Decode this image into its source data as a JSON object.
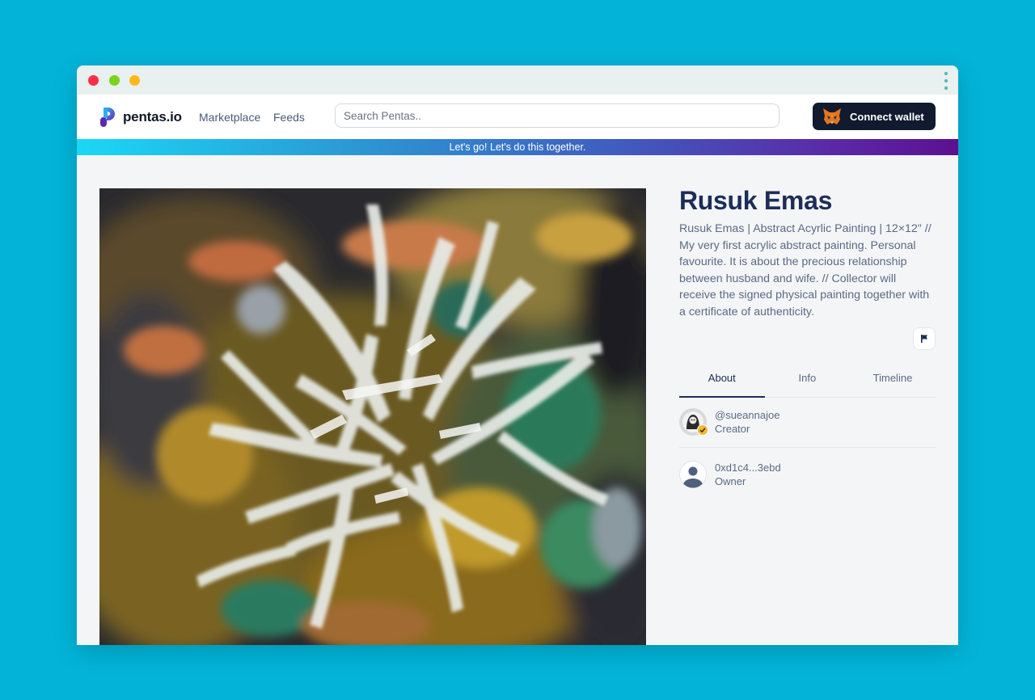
{
  "window": {
    "controls": [
      "close",
      "minimize",
      "maximize"
    ]
  },
  "brand": {
    "name": "pentas.io"
  },
  "nav": {
    "links": [
      "Marketplace",
      "Feeds"
    ]
  },
  "search": {
    "placeholder": "Search Pentas.."
  },
  "wallet": {
    "button_label": "Connect wallet",
    "icon": "metamask-fox-icon"
  },
  "banner": {
    "text": "Let's go! Let's do this together."
  },
  "artwork": {
    "title": "Rusuk Emas",
    "description": "Rusuk Emas | Abstract Acyrlic Painting | 12×12\" // My very first acrylic abstract painting. Personal favourite. It is about the precious relationship between husband and wife. // Collector will receive the signed physical painting together with a certificate of authenticity."
  },
  "actions": {
    "report_icon": "flag-icon"
  },
  "tabs": [
    {
      "label": "About",
      "active": true
    },
    {
      "label": "Info",
      "active": false
    },
    {
      "label": "Timeline",
      "active": false
    }
  ],
  "people": {
    "creator": {
      "handle": "@sueannajoe",
      "role": "Creator",
      "verified": true
    },
    "owner": {
      "handle": "0xd1c4...3ebd",
      "role": "Owner"
    }
  },
  "colors": {
    "background": "#03b4d8",
    "primary": "#1c2d57",
    "button": "#111a2e",
    "verified": "#f5b82e"
  }
}
